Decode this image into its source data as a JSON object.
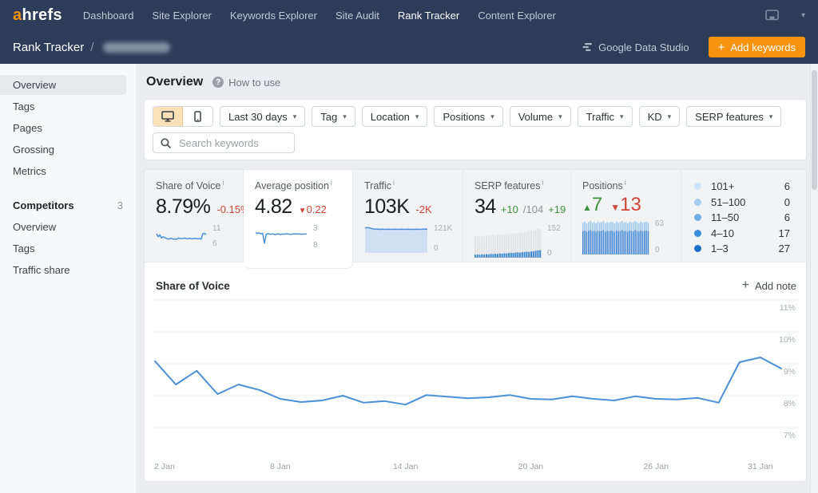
{
  "nav": {
    "logo_a": "a",
    "logo_rest": "hrefs",
    "items": [
      {
        "label": "Dashboard",
        "active": false
      },
      {
        "label": "Site Explorer",
        "active": false
      },
      {
        "label": "Keywords Explorer",
        "active": false
      },
      {
        "label": "Site Audit",
        "active": false
      },
      {
        "label": "Rank Tracker",
        "active": true
      },
      {
        "label": "Content Explorer",
        "active": false
      }
    ]
  },
  "subheader": {
    "breadcrumb": "Rank Tracker",
    "separator": "/",
    "gds_label": "Google Data Studio",
    "add_keywords_label": "Add keywords"
  },
  "sidebar": {
    "items": [
      {
        "label": "Overview"
      },
      {
        "label": "Tags"
      },
      {
        "label": "Pages"
      },
      {
        "label": "Grossing"
      },
      {
        "label": "Metrics"
      }
    ],
    "competitors": {
      "label": "Competitors",
      "count": "3"
    },
    "competitor_items": [
      {
        "label": "Overview"
      },
      {
        "label": "Tags"
      },
      {
        "label": "Traffic share"
      }
    ]
  },
  "page": {
    "title": "Overview",
    "help_label": "How to use",
    "help_q": "?"
  },
  "filters": {
    "labels": [
      "Last 30 days",
      "Tag",
      "Location",
      "Positions",
      "Volume",
      "Traffic",
      "KD",
      "SERP features"
    ],
    "search_placeholder": "Search keywords"
  },
  "ui": {
    "caret": "▾",
    "plus": "+",
    "info_i": "i",
    "tri_up": "▲",
    "tri_down": "▼"
  },
  "cards": {
    "share_of_voice": {
      "title": "Share of Voice",
      "value": "8.79%",
      "delta": "-0.15%",
      "axis_top": "11",
      "axis_bottom": "6"
    },
    "average_position": {
      "title": "Average position",
      "value": "4.82",
      "delta": "0.22",
      "axis_top": "3",
      "axis_bottom": "8"
    },
    "traffic": {
      "title": "Traffic",
      "value": "103K",
      "delta": "-2K",
      "axis_top": "121K",
      "axis_bottom": "0"
    },
    "serp_features": {
      "title": "SERP features",
      "value": "34",
      "delta": "+10",
      "total": "/104",
      "total_delta": "+19",
      "axis_top": "152",
      "axis_bottom": "0"
    },
    "positions": {
      "title": "Positions",
      "up": "7",
      "down": "13",
      "axis_top": "63",
      "axis_bottom": "0"
    }
  },
  "legend": [
    {
      "color": "#cfe3f6",
      "label": "101+",
      "value": "6"
    },
    {
      "color": "#a6cdef",
      "label": "51–100",
      "value": "0"
    },
    {
      "color": "#72aee6",
      "label": "11–50",
      "value": "6"
    },
    {
      "color": "#3a8edd",
      "label": "4–10",
      "value": "17"
    },
    {
      "color": "#1d6fc8",
      "label": "1–3",
      "value": "27"
    }
  ],
  "chart_panel": {
    "title": "Share of Voice",
    "add_note": "Add note"
  },
  "sparks": {
    "sov": {
      "type": "line",
      "range": [
        6,
        11
      ],
      "color": "#4a90d9",
      "values": [
        9.08,
        8.35,
        8.78,
        8.05,
        8.35,
        8.18,
        7.9,
        7.8,
        7.85,
        8.0,
        7.78,
        7.83,
        7.72,
        8.02,
        7.97,
        7.92,
        7.95,
        8.02,
        7.9,
        7.88,
        7.98,
        7.9,
        7.85,
        7.98,
        7.9,
        7.88,
        7.93,
        7.78,
        9.05,
        9.2,
        8.85
      ]
    },
    "avg_position": {
      "type": "line",
      "inverted": true,
      "range": [
        3,
        8
      ],
      "color": "#4a90d9",
      "values": [
        4.5,
        4.7,
        4.6,
        4.8,
        4.7,
        6.9,
        4.9,
        4.75,
        4.85,
        4.9,
        4.8,
        5.0,
        4.85,
        4.8,
        4.95,
        4.85,
        4.9,
        4.82,
        4.78,
        4.9,
        4.92,
        4.85,
        4.8,
        4.86,
        4.8,
        4.85,
        4.9,
        4.84,
        4.87,
        4.82
      ]
    },
    "traffic": {
      "type": "area",
      "range": [
        0,
        121
      ],
      "color": "#4a90d9",
      "fill": "#cfe0f4",
      "values": [
        110,
        113,
        111,
        108,
        106,
        105,
        105,
        104,
        105,
        104,
        104,
        105,
        104,
        104,
        105,
        104,
        104,
        105,
        104,
        104,
        105,
        104,
        104,
        104,
        105,
        104,
        104,
        105,
        106,
        104
      ]
    },
    "serp": {
      "type": "bars",
      "range": [
        0,
        152
      ],
      "total_color": "#e2e4e7",
      "part_color": "#3c87d0",
      "total": [
        96,
        99,
        95,
        101,
        97,
        100,
        103,
        99,
        104,
        101,
        105,
        103,
        107,
        104,
        108,
        106,
        110,
        108,
        112,
        110,
        115,
        112,
        118,
        116,
        121,
        124,
        122,
        127,
        132,
        129
      ],
      "part": [
        13,
        14,
        13,
        15,
        14,
        16,
        15,
        17,
        16,
        18,
        17,
        19,
        18,
        20,
        19,
        21,
        22,
        21,
        23,
        24,
        23,
        25,
        26,
        27,
        26,
        28,
        29,
        31,
        33,
        34
      ]
    },
    "positions": {
      "type": "stack",
      "range": [
        0,
        63
      ],
      "top_frac": 0.27,
      "top_color": "#9cc6eb",
      "bottom_color": "#4186d2",
      "values": [
        57,
        59,
        56,
        58,
        60,
        57,
        58,
        56,
        59,
        57,
        58,
        60,
        56,
        58,
        57,
        59,
        58,
        56,
        59,
        57,
        58,
        60,
        57,
        58,
        56,
        59,
        58,
        57,
        60,
        58,
        56,
        59,
        57,
        58,
        59,
        57
      ]
    }
  },
  "chart_data": {
    "type": "line",
    "title": "Share of Voice",
    "unit": "%",
    "color": "#4a90d9",
    "ylim": [
      6.5,
      11.2
    ],
    "y_ticks": [
      {
        "label": "11%",
        "value": 11
      },
      {
        "label": "10%",
        "value": 10
      },
      {
        "label": "9%",
        "value": 9
      },
      {
        "label": "8%",
        "value": 8
      },
      {
        "label": "7%",
        "value": 7
      }
    ],
    "x_labels": [
      {
        "label": "2 Jan",
        "idx": 0
      },
      {
        "label": "8 Jan",
        "idx": 6
      },
      {
        "label": "14 Jan",
        "idx": 12
      },
      {
        "label": "20 Jan",
        "idx": 18
      },
      {
        "label": "26 Jan",
        "idx": 24
      },
      {
        "label": "31 Jan",
        "idx": 29
      }
    ],
    "values": [
      9.08,
      8.35,
      8.78,
      8.05,
      8.35,
      8.18,
      7.9,
      7.8,
      7.85,
      8.0,
      7.78,
      7.83,
      7.72,
      8.02,
      7.97,
      7.92,
      7.95,
      8.02,
      7.9,
      7.88,
      7.98,
      7.9,
      7.85,
      7.98,
      7.9,
      7.88,
      7.93,
      7.78,
      9.05,
      9.2,
      8.85
    ]
  },
  "colors": {
    "navy": "#2d3c58",
    "orange": "#f7930e",
    "blue": "#4a90d9",
    "red": "#cf4437",
    "green": "#3f9142"
  }
}
